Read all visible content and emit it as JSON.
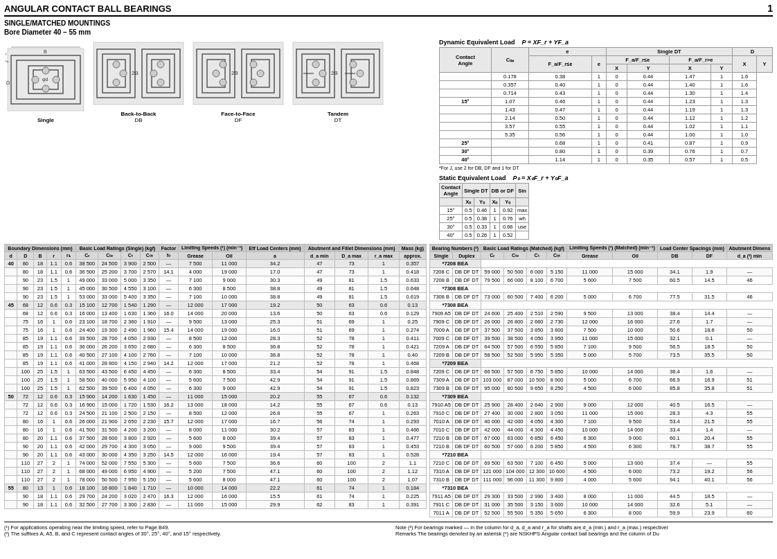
{
  "page": {
    "title": "ANGULAR CONTACT BALL BEARINGS",
    "page_num": "1",
    "subtitle": "SINGLE/MATCHED MOUNTINGS",
    "bore_diameter": "Bore Diameter   40 – 55 mm"
  },
  "diagrams": [
    {
      "label": "Single",
      "sublabel": ""
    },
    {
      "label": "Back-to-Back",
      "sublabel": "DB"
    },
    {
      "label": "Face-to-Face",
      "sublabel": "DF"
    },
    {
      "label": "Tandem",
      "sublabel": "DT"
    }
  ],
  "dynamic_load": {
    "title": "Dynamic Equivalent Load",
    "formula": "P = XF_r + YF_a",
    "header_row1": [
      "Contact",
      "",
      "Single DT",
      "",
      "",
      "",
      "",
      "D"
    ],
    "header_row2": [
      "Angle",
      "C₀ₑ",
      "F_a/F_r≤e",
      "",
      "F_a/F_r>e",
      "",
      "F_a/F_r≤e",
      ""
    ],
    "header_row3": [
      "",
      "",
      "X",
      "Y",
      "X",
      "Y",
      "X",
      "Y"
    ],
    "rows": [
      [
        "",
        "0.178",
        "0.38",
        "1",
        "0",
        "0.44",
        "1.47",
        "1",
        "1.6"
      ],
      [
        "",
        "0.357",
        "0.40",
        "1",
        "0",
        "0.44",
        "1.40",
        "1",
        "1.6"
      ],
      [
        "",
        "0.714",
        "0.43",
        "1",
        "0",
        "0.44",
        "1.30",
        "1",
        "1.4"
      ],
      [
        "15°",
        "1.07",
        "0.46",
        "1",
        "0",
        "0.44",
        "1.23",
        "1",
        "1.3"
      ],
      [
        "",
        "1.43",
        "0.47",
        "1",
        "0",
        "0.44",
        "1.19",
        "1",
        "1.3"
      ],
      [
        "",
        "2.14",
        "0.50",
        "1",
        "0",
        "0.44",
        "1.12",
        "1",
        "1.2"
      ],
      [
        "",
        "3.57",
        "0.55",
        "1",
        "0",
        "0.44",
        "1.02",
        "1",
        "1.1"
      ],
      [
        "",
        "5.35",
        "0.56",
        "1",
        "0",
        "0.44",
        "1.00",
        "1",
        "1.0"
      ],
      [
        "25°",
        "",
        "0.68",
        "1",
        "0",
        "0.41",
        "0.87",
        "1",
        "0.9"
      ],
      [
        "30°",
        "",
        "0.80",
        "1",
        "0",
        "0.39",
        "0.76",
        "1",
        "0.7"
      ],
      [
        "40°",
        "",
        "1.14",
        "1",
        "0",
        "0.35",
        "0.57",
        "1",
        "0.5"
      ]
    ],
    "note": "*For J, use 2 for DB, DF and 1 for DT"
  },
  "static_load": {
    "title": "Static Equivalent Load",
    "formula": "P₀ = X₀F_r + Y₀F_a",
    "headers": [
      "Contact",
      "Single DT",
      "",
      "DB or DF",
      "",
      "Sin"
    ],
    "subheaders": [
      "Angle",
      "X₀",
      "Y₀",
      "X₀",
      "Y₀",
      ""
    ],
    "rows": [
      [
        "15°",
        "0.5",
        "0.46",
        "1",
        "0.92",
        "ma"
      ],
      [
        "25°",
        "0.5",
        "0.38",
        "1",
        "0.76",
        "wh"
      ],
      [
        "30°",
        "0.5",
        "0.33",
        "1",
        "0.66",
        "use"
      ],
      [
        "40°",
        "0.5",
        "0.26",
        "1",
        "0.52",
        ""
      ]
    ]
  },
  "left_table": {
    "group_headers": [
      "Boundary Dimensions (mm)",
      "Basic Load Ratings (Single) (kgf)",
      "Factor",
      "Limiting Speeds (¹) (min⁻¹)",
      "Eff Load Centers (mm)",
      "Abutment and Fillet Dimensions (mm)",
      "Mass (kg)"
    ],
    "col_headers": [
      "d",
      "D",
      "B",
      "r",
      "r₁",
      "Cᵣ",
      "C₀ᵣ",
      "Cₜ",
      "C₀ₜ",
      "f₀",
      "Grease",
      "Oil",
      "a",
      "d_a min",
      "D_a max",
      "r_a max",
      "approx."
    ],
    "rows": [
      [
        "40",
        "80",
        "18",
        "1.1",
        "0.6",
        "38 500",
        "24 500",
        "3 900",
        "2 500",
        "—",
        "7 500",
        "11 000",
        "34.2",
        "47",
        "73",
        "1",
        "0.357"
      ],
      [
        "",
        "80",
        "18",
        "1.1",
        "0.6",
        "36 500",
        "25 200",
        "3 700",
        "2 570",
        "14.1",
        "4 000",
        "19 000",
        "17.0",
        "47",
        "73",
        "1",
        "0.418"
      ],
      [
        "",
        "90",
        "23",
        "1.5",
        "1",
        "49 000",
        "33 000",
        "5 000",
        "3 350",
        "—",
        "7 100",
        "9 000",
        "30.3",
        "49",
        "81",
        "1.5",
        "0.633"
      ],
      [
        "",
        "90",
        "23",
        "1.5",
        "1",
        "45 000",
        "30 500",
        "4 550",
        "3 100",
        "—",
        "6 300",
        "8 500",
        "38.8",
        "49",
        "81",
        "1.5",
        "0.648"
      ],
      [
        "",
        "90",
        "23",
        "1.5",
        "1",
        "53 000",
        "33 000",
        "5 400",
        "3 350",
        "—",
        "7 100",
        "10 000",
        "38.8",
        "49",
        "81",
        "1.5",
        "0.619"
      ],
      [
        "45",
        "68",
        "12",
        "0.6",
        "0.3",
        "15 100",
        "12 700",
        "1 540",
        "1 290",
        "—",
        "12 000",
        "17 000",
        "19.2",
        "50",
        "63",
        "0.6",
        "0.13"
      ],
      [
        "",
        "68",
        "12",
        "0.6",
        "0.3",
        "16 000",
        "13 400",
        "1 630",
        "1 360",
        "16.0",
        "14 000",
        "20 000",
        "13.6",
        "50",
        "63",
        "0.6",
        "0.129"
      ],
      [
        "",
        "75",
        "16",
        "1",
        "0.6",
        "23 100",
        "18 700",
        "2 360",
        "1 910",
        "—",
        "9 500",
        "13 000",
        "25.3",
        "51",
        "69",
        "1",
        "0.25"
      ],
      [
        "",
        "75",
        "16",
        "1",
        "0.6",
        "24 400",
        "19 300",
        "2 490",
        "1 960",
        "15.4",
        "14 000",
        "19 000",
        "16.0",
        "51",
        "69",
        "1",
        "0.274"
      ],
      [
        "",
        "85",
        "19",
        "1.1",
        "0.6",
        "39 500",
        "28 700",
        "4 050",
        "2 930",
        "—",
        "8 500",
        "12 000",
        "28.3",
        "52",
        "78",
        "1",
        "0.411"
      ],
      [
        "",
        "85",
        "19",
        "1.1",
        "0.6",
        "36 000",
        "26 200",
        "3 650",
        "2 680",
        "—",
        "6 300",
        "8 500",
        "36.8",
        "52",
        "78",
        "1",
        "0.421"
      ],
      [
        "",
        "85",
        "19",
        "1.1",
        "0.6",
        "40 500",
        "27 100",
        "4 100",
        "2 760",
        "—",
        "7 100",
        "10 000",
        "36.8",
        "52",
        "78",
        "1",
        "0.40"
      ],
      [
        "",
        "85",
        "19",
        "1.1",
        "0.6",
        "41 000",
        "28 800",
        "4 150",
        "2 940",
        "14.2",
        "12 000",
        "17 000",
        "21.2",
        "52",
        "78",
        "1",
        "0.468"
      ],
      [
        "",
        "100",
        "25",
        "1.5",
        "1",
        "63 500",
        "43 500",
        "6 450",
        "4 450",
        "—",
        "6 300",
        "8 500",
        "33.4",
        "54",
        "91",
        "1.5",
        "0.848"
      ],
      [
        "",
        "100",
        "25",
        "1.5",
        "1",
        "58 500",
        "40 000",
        "5 950",
        "4 100",
        "—",
        "5 600",
        "7 500",
        "42.9",
        "54",
        "91",
        "1.5",
        "0.869"
      ],
      [
        "",
        "100",
        "25",
        "1.5",
        "1",
        "62 500",
        "39 500",
        "6 400",
        "4 050",
        "—",
        "6 300",
        "9 000",
        "42.9",
        "54",
        "91",
        "1.5",
        "0.823"
      ],
      [
        "50",
        "72",
        "12",
        "0.6",
        "0.3",
        "15 900",
        "14 200",
        "1 630",
        "1 450",
        "—",
        "11 000",
        "15 000",
        "20.2",
        "55",
        "67",
        "0.6",
        "0.132"
      ],
      [
        "",
        "72",
        "12",
        "0.6",
        "0.3",
        "16 900",
        "15 000",
        "1 720",
        "1 530",
        "16.2",
        "13 000",
        "18 000",
        "14.2",
        "55",
        "67",
        "0.6",
        "0.13"
      ],
      [
        "",
        "72",
        "12",
        "0.6",
        "0.3",
        "24 500",
        "21 100",
        "2 500",
        "2 150",
        "—",
        "8 500",
        "12 000",
        "26.8",
        "55",
        "67",
        "1",
        "0.263"
      ],
      [
        "",
        "80",
        "16",
        "1",
        "0.6",
        "26 000",
        "21 900",
        "2 650",
        "2 230",
        "15.7",
        "12 000",
        "17 000",
        "16.7",
        "56",
        "74",
        "1",
        "0.293"
      ],
      [
        "",
        "80",
        "16",
        "1",
        "0.6",
        "41 500",
        "31 500",
        "4 200",
        "3 200",
        "—",
        "8 000",
        "11 000",
        "30.2",
        "57",
        "83",
        "1",
        "0.466"
      ],
      [
        "",
        "80",
        "20",
        "1.1",
        "0.6",
        "37 500",
        "28 600",
        "3 800",
        "2 920",
        "—",
        "5 600",
        "8 000",
        "39.4",
        "57",
        "83",
        "1",
        "0.477"
      ],
      [
        "",
        "90",
        "20",
        "1.1",
        "0.6",
        "42 000",
        "29 700",
        "4 300",
        "3 050",
        "—",
        "9 000",
        "9 500",
        "39.4",
        "57",
        "83",
        "1",
        "0.453"
      ],
      [
        "",
        "90",
        "20",
        "1.1",
        "0.6",
        "43 000",
        "30 000",
        "4 350",
        "3 250",
        "14.5",
        "12 000",
        "16 000",
        "19.4",
        "57",
        "83",
        "1",
        "0.528"
      ],
      [
        "",
        "110",
        "27",
        "2",
        "1",
        "74 000",
        "52 000",
        "7 550",
        "5 300",
        "—",
        "5 600",
        "7 500",
        "36.6",
        "60",
        "100",
        "2",
        "1.1"
      ],
      [
        "",
        "110",
        "27",
        "2",
        "1",
        "68 000",
        "49 000",
        "6 950",
        "4 900",
        "—",
        "5 200",
        "7 500",
        "47.1",
        "60",
        "100",
        "2",
        "1.12"
      ],
      [
        "",
        "110",
        "27",
        "2",
        "1",
        "78 000",
        "50 500",
        "7 950",
        "5 150",
        "—",
        "5 600",
        "8 000",
        "47.1",
        "60",
        "100",
        "2",
        "1.07"
      ],
      [
        "55",
        "80",
        "13",
        "1",
        "0.6",
        "18 100",
        "16 800",
        "1 840",
        "1 710",
        "—",
        "10 000",
        "14 000",
        "22.2",
        "61",
        "74",
        "1",
        "0.184"
      ],
      [
        "",
        "90",
        "18",
        "1.1",
        "0.6",
        "29 700",
        "24 200",
        "3 020",
        "2 470",
        "16.3",
        "12 000",
        "16 000",
        "15.5",
        "61",
        "74",
        "1",
        "0.225"
      ],
      [
        "",
        "90",
        "18",
        "1.1",
        "0.6",
        "32 500",
        "27 700",
        "3 300",
        "2 830",
        "—",
        "11 000",
        "15 000",
        "11 000",
        "29.9",
        "62",
        "83",
        "1",
        "0.391"
      ]
    ]
  },
  "right_table": {
    "col_headers": [
      "Bearing Numbers (²)",
      "Basic Load Ratings (Matched) (kgf)",
      "Limiting Speeds (¹) (Matched) (min⁻¹)",
      "Load Center Spacings (mm)",
      "Abutment Dimens"
    ],
    "sub_headers": [
      "Single",
      "Duplex",
      "Cᵣ",
      "C₀ᵣ",
      "Cₜ",
      "C₀ₜ",
      "Grease",
      "Oil",
      "DB",
      "DF",
      "d_a (²) min"
    ],
    "rows": [
      [
        "*7208 BEA",
        "",
        "",
        "",
        "",
        "",
        "",
        "",
        "",
        "",
        ""
      ],
      [
        "7208 C",
        "DB DF DT",
        "59 000",
        "50 500",
        "6 000",
        "5 150",
        "11 000",
        "15 000",
        "34.1",
        "1.9",
        "—"
      ],
      [
        "7208 B",
        "DB DF DT",
        "79 500",
        "66 000",
        "8 100",
        "6 700",
        "5 600",
        "7 500",
        "60.5",
        "14.5",
        "46"
      ],
      [
        "*7308 BEA",
        "",
        "",
        "",
        "",
        "",
        "",
        "",
        "",
        "",
        ""
      ],
      [
        "7308 B",
        "DB DF DT",
        "73 000",
        "60 500",
        "7 400",
        "6 200",
        "5 000",
        "6 700",
        "77.5",
        "31.5",
        "46"
      ],
      [
        "*7308 BEA",
        "",
        "",
        "",
        "",
        "",
        "",
        "",
        "",
        "",
        ""
      ],
      [
        "7909 A5",
        "DB DF DT",
        "24 600",
        "25 400",
        "2 510",
        "2 590",
        "9 500",
        "13 000",
        "38.4",
        "14.4",
        "—"
      ],
      [
        "7909 C",
        "DB DF DT",
        "26 000",
        "26 800",
        "2 660",
        "2 730",
        "12 000",
        "16 000",
        "27.6",
        "1.7",
        "—"
      ],
      [
        "7009 A",
        "DB DF DT",
        "37 500",
        "37 500",
        "3 850",
        "3 800",
        "7 500",
        "10 000",
        "50.6",
        "18.6",
        "50"
      ],
      [
        "7009 C",
        "DB DF DT",
        "39 500",
        "38 500",
        "4 050",
        "3 950",
        "11 000",
        "15 000",
        "32.1",
        "0.1",
        "—"
      ],
      [
        "7209 A",
        "DB DF DT",
        "64 500",
        "57 500",
        "6 550",
        "5 850",
        "7 100",
        "9 500",
        "56.5",
        "18.5",
        "50"
      ],
      [
        "7209 B",
        "DB DF DT",
        "58 500",
        "52 500",
        "5 950",
        "5 350",
        "5 000",
        "5 700",
        "73.5",
        "35.5",
        "50"
      ],
      [
        "*7209 BEA",
        "",
        "",
        "",
        "",
        "",
        "",
        "",
        "",
        "",
        ""
      ],
      [
        "7209 C",
        "DB DF DT",
        "66 500",
        "57 500",
        "6 750",
        "5 850",
        "10 000",
        "14 000",
        "36.4",
        "1.6",
        "—"
      ],
      [
        "7309 A",
        "DB DF DT",
        "103 000",
        "87 000",
        "10 500",
        "8 900",
        "5 000",
        "6 700",
        "66.9",
        "16.9",
        "51"
      ],
      [
        "7309 B",
        "DB DF DT",
        "95 000",
        "80 500",
        "9 650",
        "8 250",
        "4 500",
        "6 000",
        "85.8",
        "35.8",
        "51"
      ],
      [
        "*7309 BEA",
        "",
        "",
        "",
        "",
        "",
        "",
        "",
        "",
        "",
        ""
      ],
      [
        "7910 A5",
        "DB DF DT",
        "25 900",
        "28 400",
        "2 640",
        "2 900",
        "9 000",
        "12 000",
        "40.5",
        "16.5",
        "—"
      ],
      [
        "7910 C",
        "DB DF DT",
        "27 400",
        "30 000",
        "2 800",
        "3 050",
        "11 000",
        "15 000",
        "28.3",
        "4.3",
        "55"
      ],
      [
        "7010 A",
        "DB DF DT",
        "40 000",
        "42 000",
        "4 050",
        "4 300",
        "7 100",
        "9 500",
        "53.4",
        "21.5",
        "55"
      ],
      [
        "7010 C",
        "DB DF DT",
        "42 000",
        "44 000",
        "4 300",
        "4 450",
        "10 000",
        "14 000",
        "33.4",
        "1.4",
        "—"
      ],
      [
        "7210 B",
        "DB DF DT",
        "67 000",
        "63 000",
        "6 850",
        "6 450",
        "6 300",
        "9 000",
        "60.1",
        "20.4",
        "55"
      ],
      [
        "7210 B",
        "DB DF DT",
        "60 500",
        "57 000",
        "6 200",
        "5 850",
        "4 500",
        "6 300",
        "78.7",
        "38.7",
        "55"
      ],
      [
        "*7210 BEA",
        "",
        "",
        "",
        "",
        "",
        "",
        "",
        "",
        "",
        ""
      ],
      [
        "7210 C",
        "DB DF DT",
        "69 500",
        "63 500",
        "7 100",
        "6 450",
        "5 000",
        "13 000",
        "37.4",
        "—",
        "55"
      ],
      [
        "7310 A",
        "DB DF DT",
        "121 000",
        "104 000",
        "12 300",
        "10 600",
        "4 500",
        "6 000",
        "73.2",
        "19.2",
        "56"
      ],
      [
        "7310 B",
        "DB DF DT",
        "111 000",
        "96 000",
        "11 300",
        "9 800",
        "4 000",
        "5 600",
        "94.1",
        "40.1",
        "56"
      ],
      [
        "*7310 BEA",
        "",
        "",
        "",
        "",
        "",
        "",
        "",
        "",
        "",
        ""
      ],
      [
        "7911 A5",
        "DB DF DT",
        "29 300",
        "33 500",
        "2 990",
        "3 400",
        "8 000",
        "11 000",
        "44.5",
        "18.5",
        "—"
      ],
      [
        "7911 C",
        "DB DF DT",
        "31 000",
        "35 500",
        "3 150",
        "3 600",
        "10 000",
        "14 000",
        "32.6",
        "5.1",
        "—"
      ],
      [
        "7011 A",
        "DB DF DT",
        "52 500",
        "55 500",
        "5 350",
        "5 650",
        "6 300",
        "8 000",
        "59.9",
        "23.9",
        "60"
      ]
    ]
  },
  "notes": {
    "left": [
      "(¹) For applications operating near the limiting speed, refer to Page B49.",
      "(²) The suffixes A, A5, B, and C represent contact angles of 30°, 25°, 40°, and 15° respectively."
    ],
    "right": [
      "Note  (²) For bearings marked — in the column for d_a, d_a and r_a for shafts are d_a (min.) and r_a (max.) respectivel",
      "Remarks  The bearings denoted by an asterisk (*) are NSKHPS Angular contact ball bearings and the column of Du"
    ]
  }
}
